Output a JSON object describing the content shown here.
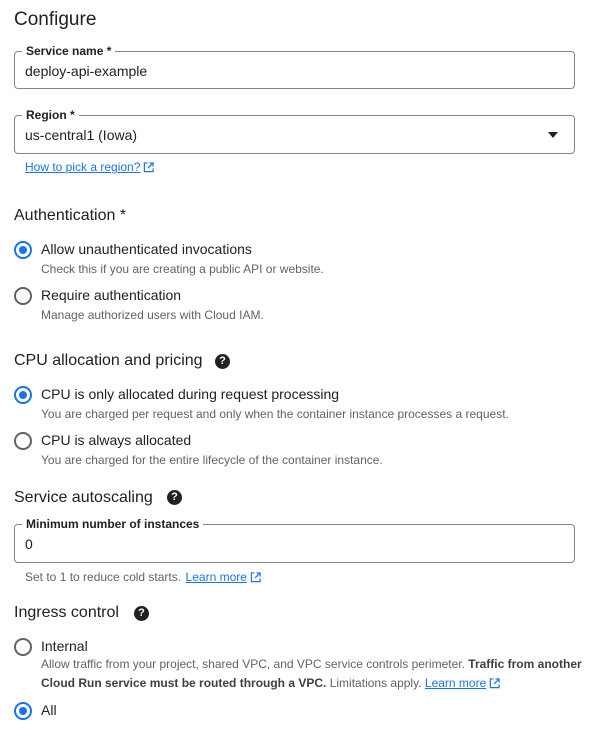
{
  "page_title": "Configure",
  "service_name": {
    "label": "Service name *",
    "value": "deploy-api-example"
  },
  "region": {
    "label": "Region *",
    "value": "us-central1 (Iowa)",
    "help_link": "How to pick a region?"
  },
  "authentication": {
    "heading": "Authentication *",
    "options": [
      {
        "label": "Allow unauthenticated invocations",
        "description": "Check this if you are creating a public API or website.",
        "checked": true
      },
      {
        "label": "Require authentication",
        "description": "Manage authorized users with Cloud IAM.",
        "checked": false
      }
    ]
  },
  "cpu": {
    "heading": "CPU allocation and pricing",
    "help_icon": "?",
    "options": [
      {
        "label": "CPU is only allocated during request processing",
        "description": "You are charged per request and only when the container instance processes a request.",
        "checked": true
      },
      {
        "label": "CPU is always allocated",
        "description": "You are charged for the entire lifecycle of the container instance.",
        "checked": false
      }
    ]
  },
  "autoscaling": {
    "heading": "Service autoscaling",
    "help_icon": "?",
    "min_instances_label": "Minimum number of instances",
    "min_instances_value": "0",
    "hint": "Set to 1 to reduce cold starts.",
    "learn_more": "Learn more"
  },
  "ingress": {
    "heading": "Ingress control",
    "help_icon": "?",
    "options": [
      {
        "label": "Internal",
        "checked": false,
        "desc_1": "Allow traffic from your project, shared VPC, and VPC service controls perimeter.",
        "desc_bold_1": "Traffic from",
        "desc_bold_2": "another Cloud Run service must be routed through a VPC.",
        "desc_2": "Limitations apply.",
        "learn_more": "Learn more"
      },
      {
        "label": "All",
        "checked": true
      }
    ]
  },
  "colors": {
    "accent": "#1a73e8",
    "text": "#202124",
    "secondary": "#5f6368"
  },
  "icons": {
    "external_link": "open-in-new-icon",
    "help": "help-circle-icon",
    "dropdown": "arrow-drop-down-icon"
  }
}
